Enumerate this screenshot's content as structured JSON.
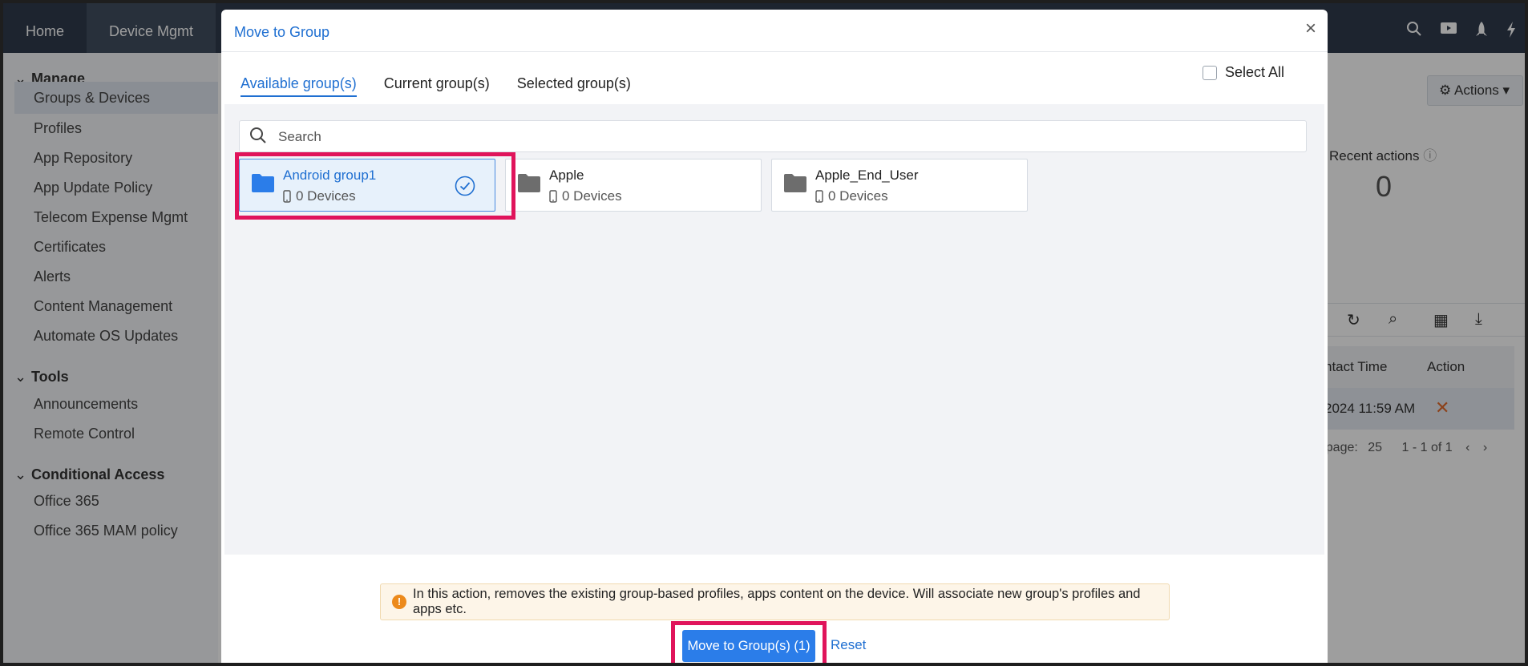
{
  "topnav": {
    "items": [
      "Home",
      "Device Mgmt"
    ],
    "icons": [
      "search-icon",
      "video-icon",
      "rocket-icon",
      "bolt-icon"
    ]
  },
  "sidebar": {
    "sections": [
      {
        "title": "Manage",
        "items": [
          "Groups & Devices",
          "Profiles",
          "App Repository",
          "App Update Policy",
          "Telecom Expense Mgmt",
          "Certificates",
          "Alerts",
          "Content Management",
          "Automate OS Updates"
        ]
      },
      {
        "title": "Tools",
        "items": [
          "Announcements",
          "Remote Control"
        ]
      },
      {
        "title": "Conditional Access",
        "items": [
          "Office 365",
          "Office 365 MAM policy"
        ]
      }
    ],
    "selected": "Groups & Devices"
  },
  "background": {
    "actions_label": "Actions",
    "recent_actions_label": "Recent actions",
    "recent_actions_value": "0",
    "table": {
      "col_contact": "ntact Time",
      "col_action": "Action",
      "row_contact": "2024 11:59 AM"
    },
    "pager": {
      "per_page_label": "r page:",
      "per_page_value": "25",
      "range": "1 - 1 of 1"
    }
  },
  "modal": {
    "title": "Move to Group",
    "tabs": [
      "Available group(s)",
      "Current group(s)",
      "Selected group(s)"
    ],
    "active_tab": "Available group(s)",
    "select_all_label": "Select All",
    "search_placeholder": "Search",
    "groups": [
      {
        "name": "Android group1",
        "devices": "0 Devices",
        "selected": true
      },
      {
        "name": "Apple",
        "devices": "0 Devices",
        "selected": false
      },
      {
        "name": "Apple_End_User",
        "devices": "0 Devices",
        "selected": false
      }
    ],
    "warning_text": "In this action, removes the existing group-based profiles, apps content on the device. Will associate new group's profiles and apps etc.",
    "move_button_label": "Move to Group(s) (1)",
    "reset_label": "Reset"
  },
  "colors": {
    "accent": "#1f6fd1",
    "primary_button": "#2b7de9",
    "highlight": "#e0145b",
    "warning": "#ec8a1c",
    "topbar": "#2f3b4d"
  }
}
